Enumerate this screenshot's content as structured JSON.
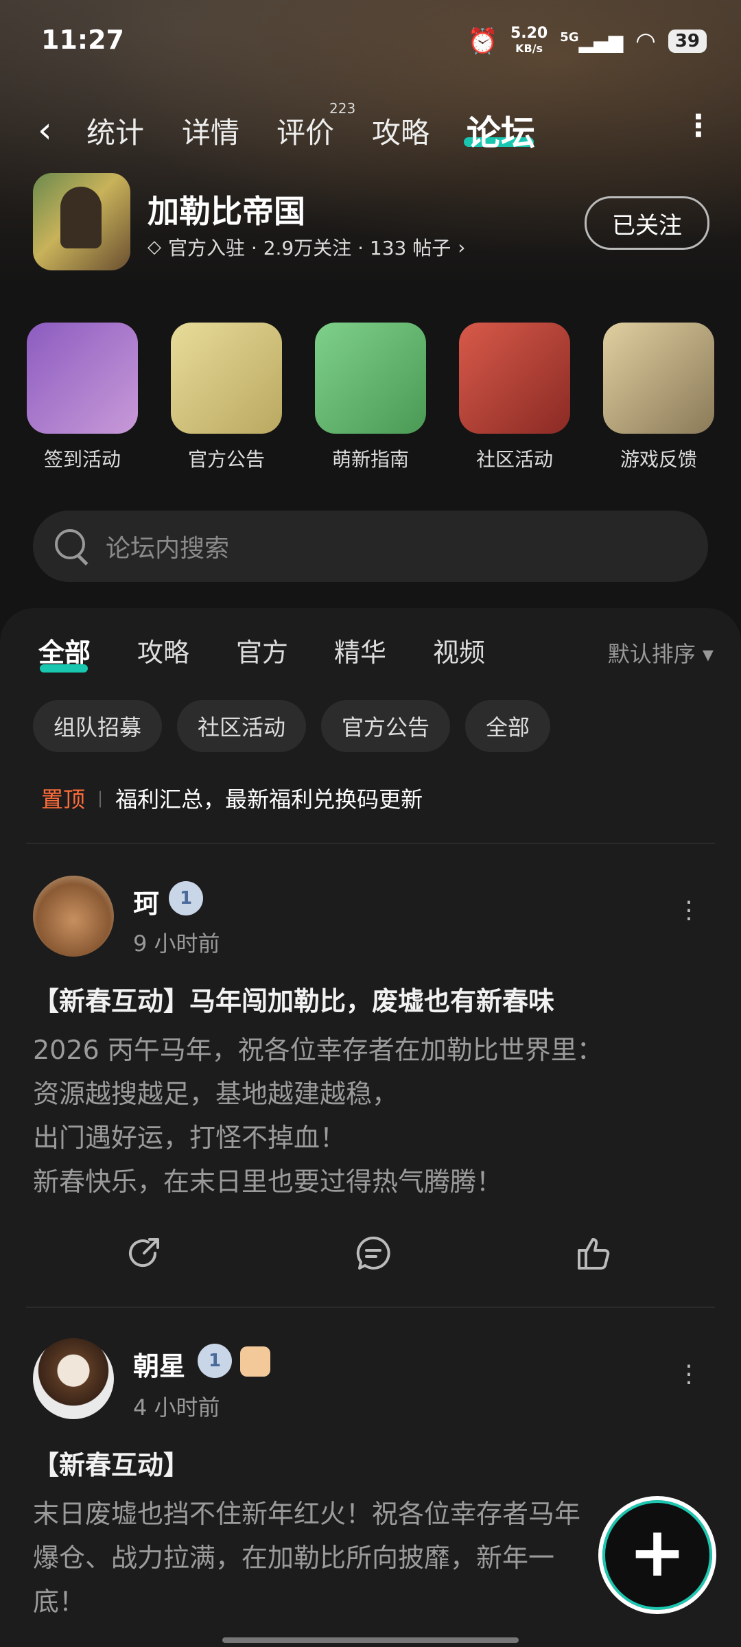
{
  "status_bar": {
    "time": "11:27",
    "net_speed": "5.20",
    "net_unit": "KB/s",
    "network": "5G",
    "battery": "39"
  },
  "top_tabs": {
    "items": [
      "统计",
      "详情",
      "评价",
      "攻略",
      "论坛"
    ],
    "active": "论坛",
    "review_count": "223"
  },
  "game": {
    "title": "加勒比帝国",
    "meta": "官方入驻 · 2.9万关注 · 133 帖子",
    "follow_label": "已关注"
  },
  "categories": [
    {
      "label": "签到活动",
      "color": "#7a4aa0"
    },
    {
      "label": "官方公告",
      "color": "#d8c97a"
    },
    {
      "label": "萌新指南",
      "color": "#6ac06a"
    },
    {
      "label": "社区活动",
      "color": "#c0453a"
    },
    {
      "label": "游戏反馈",
      "color": "#c9b68a"
    }
  ],
  "search": {
    "placeholder": "论坛内搜索"
  },
  "filter_tabs": {
    "items": [
      "全部",
      "攻略",
      "官方",
      "精华",
      "视频"
    ],
    "active": "全部",
    "sort_label": "默认排序 ▾"
  },
  "chips": [
    "组队招募",
    "社区活动",
    "官方公告",
    "全部"
  ],
  "pinned": {
    "tag": "置顶",
    "text": "福利汇总，最新福利兑换码更新"
  },
  "posts": [
    {
      "user": "珂",
      "level": "1",
      "time": "9 小时前",
      "title": "【新春互动】马年闯加勒比，废墟也有新春味",
      "lines": [
        "2026 丙午马年，祝各位幸存者在加勒比世界里：",
        "资源越搜越足，基地越建越稳，",
        "出门遇好运，打怪不掉血！",
        "新春快乐，在末日里也要过得热气腾腾！"
      ]
    },
    {
      "user": "朝星",
      "level": "1",
      "time": "4 小时前",
      "title": "【新春互动】",
      "lines": [
        "末日废墟也挡不住新年红火！祝各位幸存者马年",
        "爆仓、战力拉满，在加勒比所向披靡，新年一",
        "底！"
      ]
    }
  ]
}
